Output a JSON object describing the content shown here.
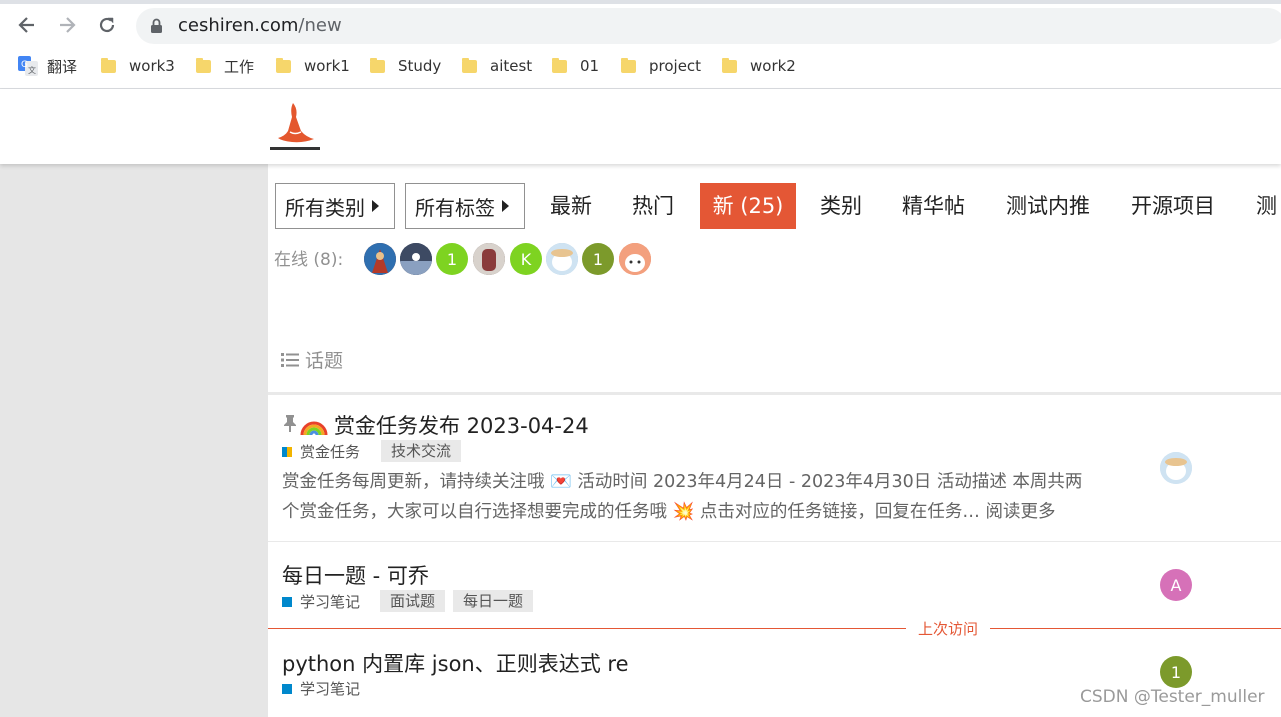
{
  "browser": {
    "url_host": "ceshiren.com",
    "url_path": "/new",
    "bookmarks": [
      {
        "label": "翻译",
        "icon": "google-translate-icon"
      },
      {
        "label": "work3",
        "icon": "folder-icon"
      },
      {
        "label": "工作",
        "icon": "folder-icon"
      },
      {
        "label": "work1",
        "icon": "folder-icon"
      },
      {
        "label": "Study",
        "icon": "folder-icon"
      },
      {
        "label": "aitest",
        "icon": "folder-icon"
      },
      {
        "label": "01",
        "icon": "folder-icon"
      },
      {
        "label": "project",
        "icon": "folder-icon"
      },
      {
        "label": "work2",
        "icon": "folder-icon"
      }
    ]
  },
  "nav": {
    "all_categories": "所有类别",
    "all_tags": "所有标签",
    "latest": "最新",
    "hot": "热门",
    "new": "新 (25)",
    "categories": "类别",
    "featured": "精华帖",
    "referrals": "测试内推",
    "open_source": "开源项目",
    "more_cut": "测"
  },
  "online": {
    "label": "在线 (8):",
    "avatars": [
      {
        "kind": "photo",
        "color": "#8a3b2a"
      },
      {
        "kind": "photo",
        "color": "#3d4a63"
      },
      {
        "kind": "letter",
        "letter": "1",
        "color": "#7ed321"
      },
      {
        "kind": "photo",
        "color": "#6b5a55"
      },
      {
        "kind": "letter",
        "letter": "K",
        "color": "#7ed321"
      },
      {
        "kind": "photo",
        "color": "#a9c7de"
      },
      {
        "kind": "letter",
        "letter": "1",
        "color": "#7c9a2b"
      },
      {
        "kind": "photo",
        "color": "#e8866a"
      }
    ]
  },
  "topics": {
    "header": "话题",
    "last_visit": "上次访问",
    "items": [
      {
        "title": "赏金任务发布 2023-04-24",
        "category": "赏金任务",
        "category_color": "#f2b400",
        "tags": [
          "技术交流"
        ],
        "excerpt_line1": "赏金任务每周更新，请持续关注哦 💌 活动时间 2023年4月24日 - 2023年4月30日 活动描述 本周共两",
        "excerpt_line2": "个赏金任务，大家可以自行选择想要完成的任务哦 💥 点击对应的任务链接，回复在任务… 阅读更多"
      },
      {
        "title": "每日一题 - 可乔",
        "category": "学习笔记",
        "category_color": "#0088cc",
        "tags": [
          "面试题",
          "每日一题"
        ],
        "avatar_letter": "A",
        "avatar_color": "#d671b8"
      },
      {
        "title": "python 内置库 json、正则表达式 re",
        "category": "学习笔记",
        "category_color": "#0088cc",
        "tags": [],
        "avatar_letter": "1",
        "avatar_color": "#7c9a2b"
      }
    ]
  },
  "watermark": "CSDN @Tester_muller"
}
